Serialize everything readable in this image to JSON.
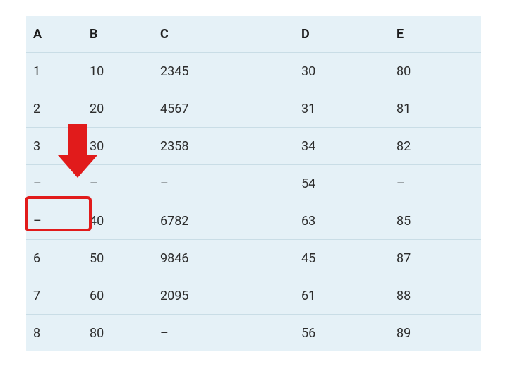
{
  "table": {
    "columns": [
      "A",
      "B",
      "C",
      "D",
      "E"
    ],
    "rows": [
      {
        "A": "1",
        "B": "10",
        "C": "2345",
        "D": "30",
        "E": "80"
      },
      {
        "A": "2",
        "B": "20",
        "C": "4567",
        "D": "31",
        "E": "81"
      },
      {
        "A": "3",
        "B": "30",
        "C": "2358",
        "D": "34",
        "E": "82"
      },
      {
        "A": "–",
        "B": "–",
        "C": "–",
        "D": "54",
        "E": "–"
      },
      {
        "A": "–",
        "B": "40",
        "C": "6782",
        "D": "63",
        "E": "85"
      },
      {
        "A": "6",
        "B": "50",
        "C": "9846",
        "D": "45",
        "E": "87"
      },
      {
        "A": "7",
        "B": "60",
        "C": "2095",
        "D": "61",
        "E": "88"
      },
      {
        "A": "8",
        "B": "80",
        "C": "–",
        "D": "56",
        "E": "89"
      }
    ]
  },
  "annotations": {
    "arrow_color": "#e11b1b",
    "highlight_color": "#e11b1b"
  }
}
